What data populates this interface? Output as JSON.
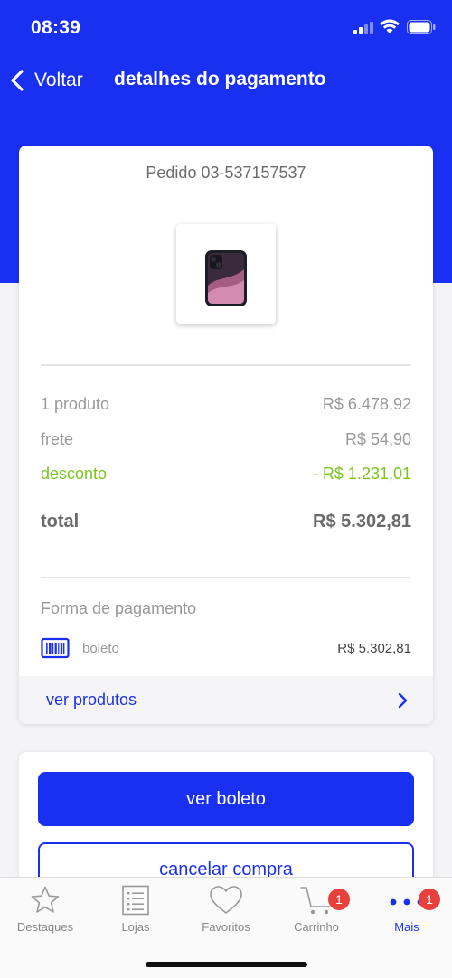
{
  "status_bar": {
    "time": "08:39"
  },
  "nav": {
    "back_label": "Voltar",
    "title": "detalhes do pagamento"
  },
  "order": {
    "id": "Pedido 03-537157537",
    "summary": [
      {
        "label": "1 produto",
        "value": "R$ 6.478,92",
        "kind": "normal"
      },
      {
        "label": "frete",
        "value": "R$ 54,90",
        "kind": "normal"
      },
      {
        "label": "desconto",
        "value": "- R$ 1.231,01",
        "kind": "discount"
      }
    ],
    "total": {
      "label": "total",
      "value": "R$ 5.302,81"
    }
  },
  "payment": {
    "title": "Forma de pagamento",
    "method": "boleto",
    "method_icon": "barcode-icon",
    "value": "R$ 5.302,81"
  },
  "ver_produtos": {
    "label": "ver produtos"
  },
  "actions": {
    "primary": "ver boleto",
    "secondary": "cancelar compra"
  },
  "tabbar": {
    "items": [
      {
        "label": "Destaques",
        "icon": "star-icon",
        "active": false,
        "badge": ""
      },
      {
        "label": "Lojas",
        "icon": "list-icon",
        "active": false,
        "badge": ""
      },
      {
        "label": "Favoritos",
        "icon": "heart-icon",
        "active": false,
        "badge": ""
      },
      {
        "label": "Carrinho",
        "icon": "cart-icon",
        "active": false,
        "badge": "1"
      },
      {
        "label": "Mais",
        "icon": "more-dots-icon",
        "active": true,
        "badge": "1"
      }
    ]
  },
  "colors": {
    "brand": "#1a30f0",
    "discount": "#7ac61e",
    "badge": "#e8403a"
  }
}
